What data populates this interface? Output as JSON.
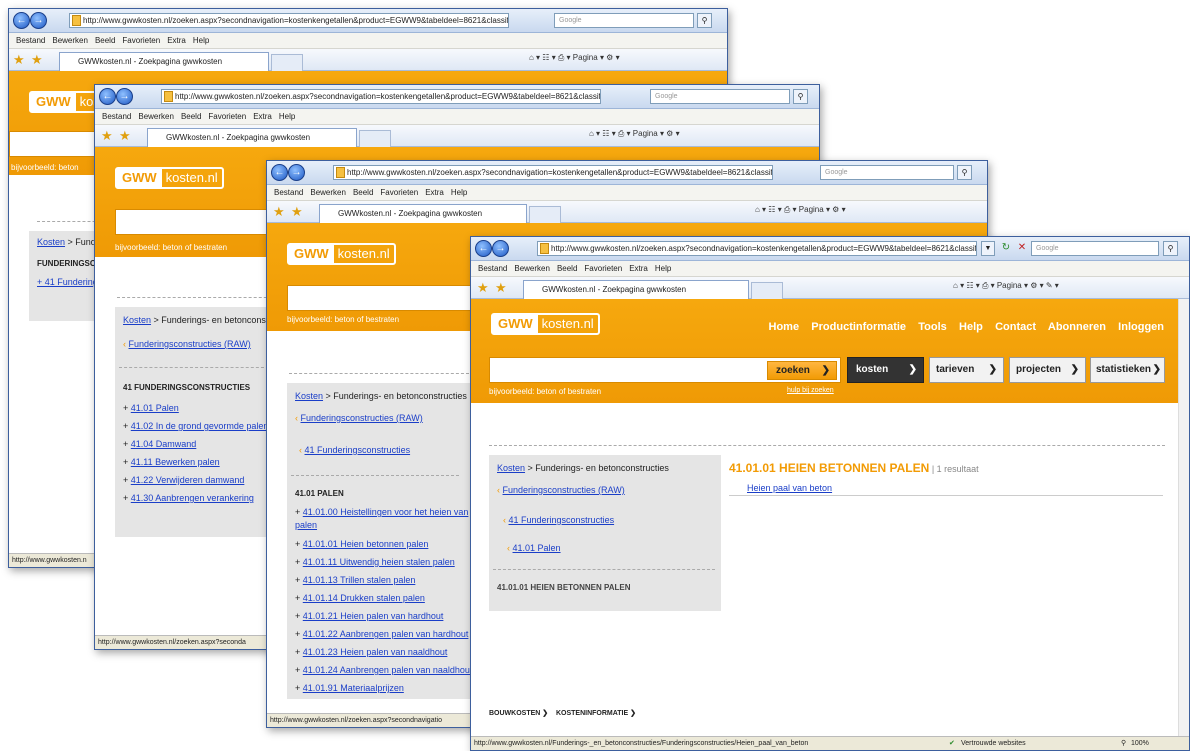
{
  "browser": {
    "url": "http://www.gwwkosten.nl/zoeken.aspx?secondnavigation=kostenkengetallen&product=EGWW9&tabeldeel=8621&classifi",
    "search_placeholder": "Google",
    "menu": [
      "Bestand",
      "Bewerken",
      "Beeld",
      "Favorieten",
      "Extra",
      "Help"
    ],
    "tab_title": "GWWkosten.nl - Zoekpagina gwwkosten",
    "page_label": "Pagina",
    "status_url_short": "http://www.gwwkosten.n",
    "status_url_2": "http://www.gwwkosten.nl/zoeken.aspx?seconda",
    "status_url_3": "http://www.gwwkosten.nl/zoeken.aspx?secondnavigatio",
    "status_url_front": "http://www.gwwkosten.nl/Funderings-_en_betonconstructies/Funderingsconstructies/Heien_paal_van_beton",
    "trusted_sites": "Vertrouwde websites",
    "zoom": "100%"
  },
  "site": {
    "logo_gww": "GWW",
    "logo_kosten": "kosten.nl",
    "logo_kosten_partial": "kost",
    "search_hint": "bijvoorbeeld: beton of bestraten",
    "search_hint_short": "bijvoorbeeld: beton",
    "help_link": "hulp bij zoeken",
    "nav": [
      "Home",
      "Productinformatie",
      "Tools",
      "Help",
      "Contact",
      "Abonneren",
      "Inloggen"
    ],
    "buttons": {
      "zoeken": "zoeken",
      "kosten": "kosten",
      "tarieven": "tarieven",
      "projecten": "projecten",
      "statistieken": "statistieken"
    },
    "footer": [
      "BOUWKOSTEN",
      "KOSTENINFORMATIE"
    ]
  },
  "windows": {
    "w1": {
      "breadcrumb_link": "Kosten",
      "breadcrumb_rest": " > Funde",
      "heading": "FUNDERINGSCO",
      "item": "+ 41 Funderings"
    },
    "w2": {
      "breadcrumb_link": "Kosten",
      "breadcrumb_rest": " > Funderings- en betonconst",
      "back": "Funderingsconstructies (RAW)",
      "heading": "41 FUNDERINGSCONSTRUCTIES",
      "items": [
        "41.01 Palen",
        "41.02 In de grond gevormde palen",
        "41.04 Damwand",
        "41.11 Bewerken palen",
        "41.22 Verwijderen damwand",
        "41.30 Aanbrengen verankering"
      ]
    },
    "w3": {
      "breadcrumb_link": "Kosten",
      "breadcrumb_rest": " > Funderings- en betonconstructies",
      "back1": "Funderingsconstructies (RAW)",
      "back2": "41 Funderingsconstructies",
      "heading": "41.01 PALEN",
      "items": [
        "41.01.00 Heistellingen voor het heien van",
        "palen",
        "41.01.01 Heien betonnen palen",
        "41.01.11 Uitwendig heien stalen palen",
        "41.01.13 Trillen stalen palen",
        "41.01.14 Drukken stalen palen",
        "41.01.21 Heien palen van hardhout",
        "41.01.22 Aanbrengen palen van hardhout",
        "41.01.23 Heien palen van naaldhout",
        "41.01.24 Aanbrengen palen van naaldhout",
        "41.01.91 Materiaalprijzen"
      ]
    },
    "w4": {
      "breadcrumb_link": "Kosten",
      "breadcrumb_rest": " > Funderings- en betonconstructies",
      "back1": "Funderingsconstructies (RAW)",
      "back2": "41 Funderingsconstructies",
      "back3": "41.01 Palen",
      "side_heading": "41.01.01 HEIEN BETONNEN PALEN",
      "result_title": "41.01.01 HEIEN BETONNEN PALEN",
      "result_count": "1 resultaat",
      "result_link": "Heien paal van beton"
    }
  },
  "colors": {
    "orange": "#f29b05",
    "link": "#1a3ec8"
  }
}
